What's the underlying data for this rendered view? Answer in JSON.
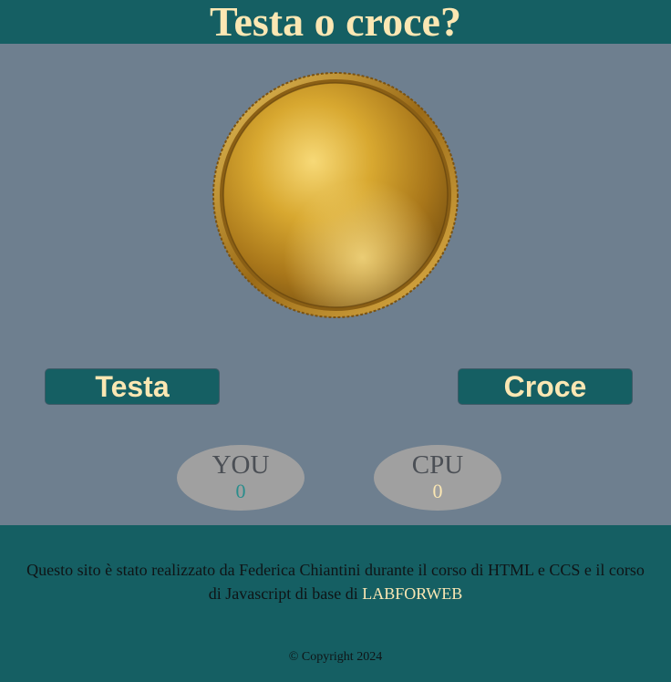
{
  "header": {
    "title": "Testa o croce?"
  },
  "coin": {
    "icon": "gold-coin-icon"
  },
  "buttons": {
    "heads_label": "Testa",
    "tails_label": "Croce"
  },
  "scores": {
    "you_label": "YOU",
    "you_value": "0",
    "cpu_label": "CPU",
    "cpu_value": "0"
  },
  "footer": {
    "text": "Questo sito è stato realizzato da Federica Chiantini durante il corso di HTML e CCS e il corso di Javascript di base di",
    "link_text": "LABFORWEB",
    "copyright": "© Copyright 2024"
  },
  "colors": {
    "header_bg": "#155f63",
    "page_bg": "#6e7f8f",
    "accent_text": "#fbe7b3",
    "score_bg": "#a0a0a0"
  }
}
